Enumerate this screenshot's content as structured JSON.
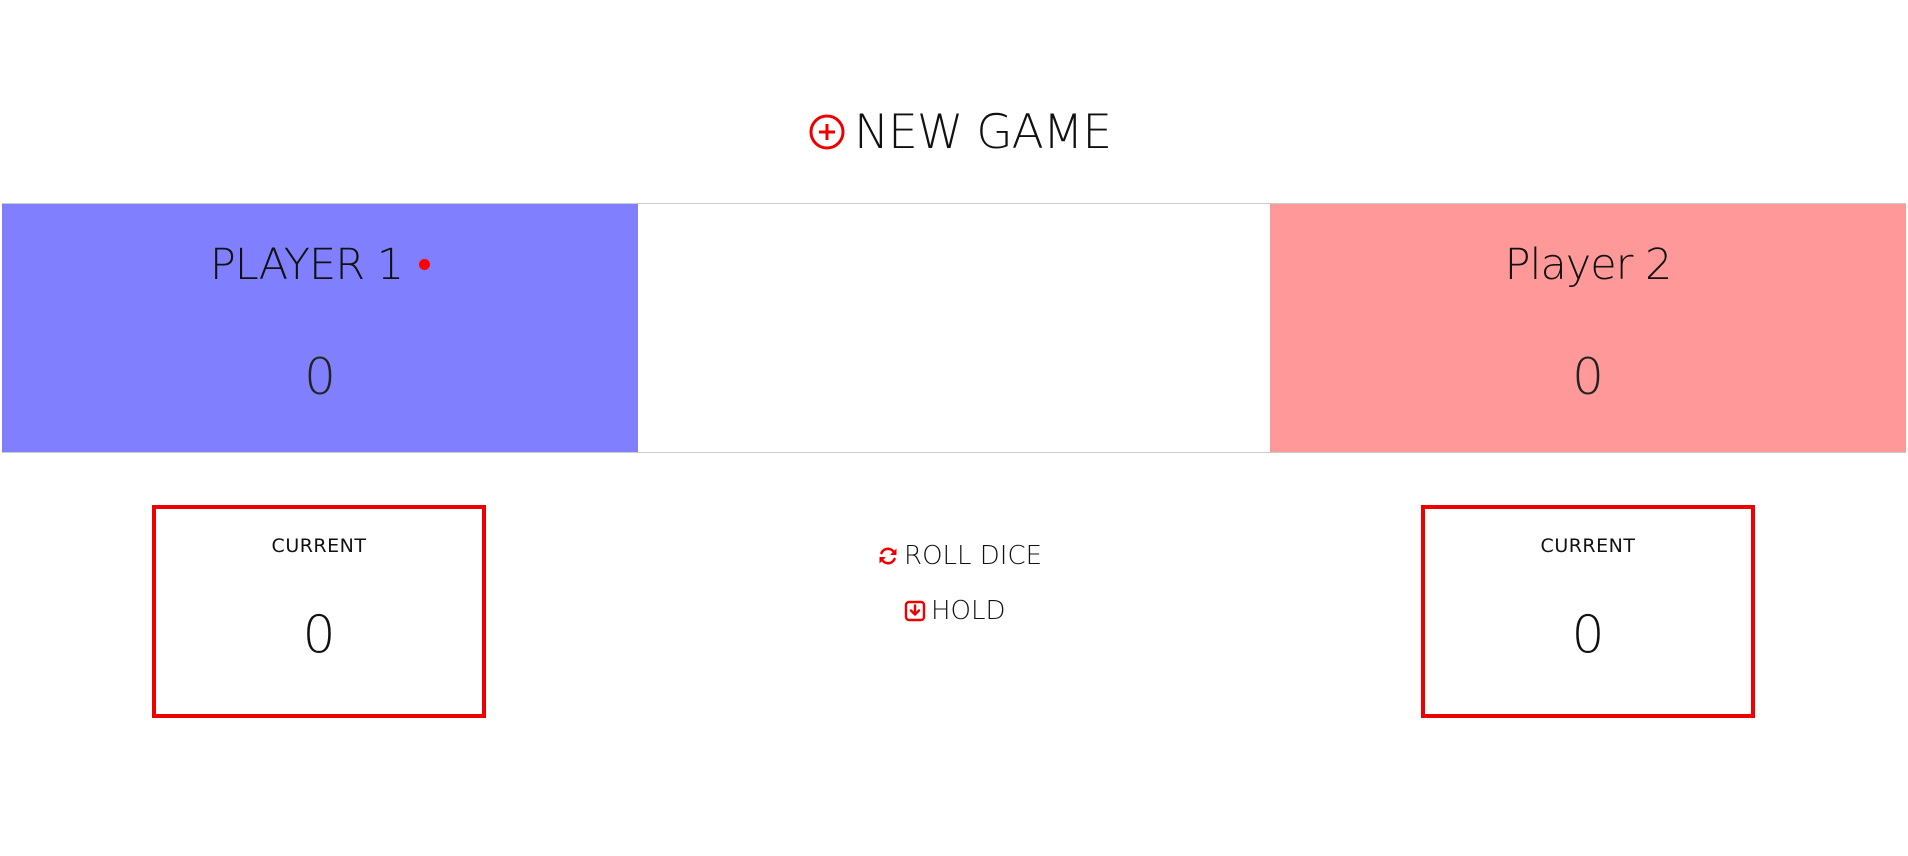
{
  "controls": {
    "new_game_label": "NEW GAME",
    "new_game_icon": "plus-circle-icon",
    "roll_dice_label": "ROLL DICE",
    "roll_dice_icon": "refresh-icon",
    "hold_label": "HOLD",
    "hold_icon": "download-square-icon"
  },
  "players": [
    {
      "name": "PLAYER 1",
      "score": "0",
      "current_label": "CURRENT",
      "current_score": "0",
      "active": true,
      "panel_color": "#8080ff"
    },
    {
      "name": "Player 2",
      "score": "0",
      "current_label": "CURRENT",
      "current_score": "0",
      "active": false,
      "panel_color": "#ff9999"
    }
  ],
  "colors": {
    "accent": "#ee0000",
    "active_indicator": "#ff0000"
  }
}
